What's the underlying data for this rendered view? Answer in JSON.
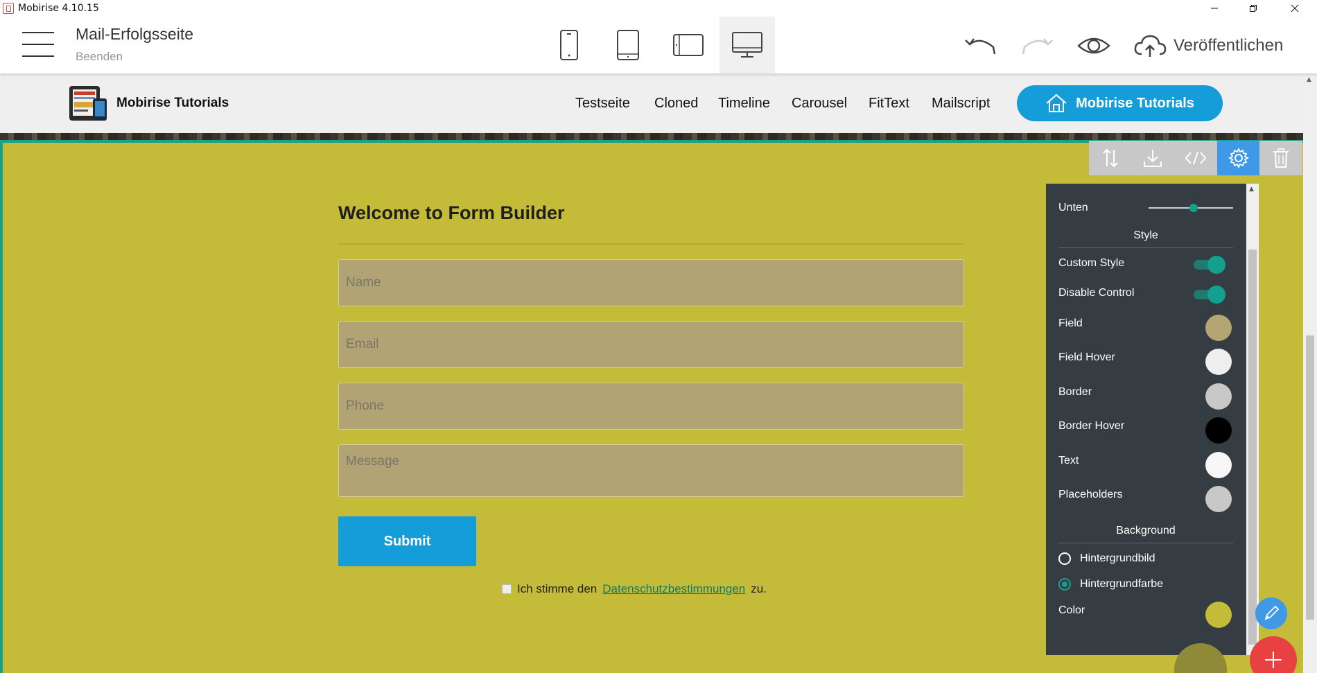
{
  "window": {
    "title": "Mobirise 4.10.15"
  },
  "header": {
    "page_title": "Mail-Erfolgsseite",
    "page_subtitle": "Beenden",
    "publish_label": "Veröffentlichen",
    "devices": [
      "phone-icon",
      "tablet-icon",
      "tablet-landscape-icon",
      "desktop-icon"
    ],
    "active_device": "desktop-icon"
  },
  "site": {
    "brand": "Mobirise Tutorials",
    "nav": [
      "Testseite",
      "Cloned",
      "Timeline",
      "Carousel",
      "FitText",
      "Mailscript"
    ],
    "cta_label": "Mobirise Tutorials"
  },
  "form": {
    "heading": "Welcome to Form Builder",
    "name_placeholder": "Name",
    "email_placeholder": "Email",
    "phone_placeholder": "Phone",
    "message_placeholder": "Message",
    "submit_label": "Submit",
    "consent_prefix": "Ich stimme den",
    "consent_link": "Datenschutzbestimmungen",
    "consent_suffix": "zu."
  },
  "panel": {
    "bottom_label": "Unten",
    "style_section": "Style",
    "custom_style": "Custom Style",
    "disable_control": "Disable Control",
    "field": "Field",
    "field_hover": "Field Hover",
    "border": "Border",
    "border_hover": "Border Hover",
    "text": "Text",
    "placeholders": "Placeholders",
    "background_section": "Background",
    "bg_image": "Hintergrundbild",
    "bg_color": "Hintergrundfarbe",
    "color": "Color",
    "custom_style_on": true,
    "disable_control_on": true,
    "selected_background": "Hintergrundfarbe"
  },
  "colors": {
    "block_bg": "#c4bc38",
    "accent": "#149dd8",
    "selection": "#1aa28a",
    "field": "#b3a672",
    "field_hover": "#eeeeee",
    "border": "#c8c8c8",
    "border_hover": "#000000",
    "text": "#f7f7f7",
    "placeholders": "#c8c8c8",
    "color": "#c4bc38"
  }
}
